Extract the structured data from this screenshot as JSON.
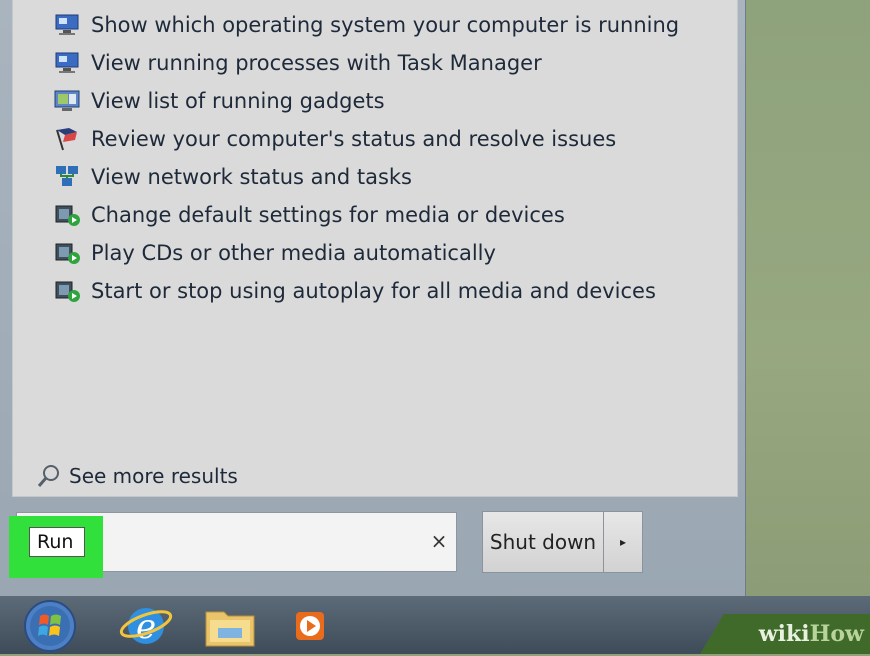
{
  "results": [
    {
      "label": "Show which operating system your computer is running",
      "icon": "system-icon"
    },
    {
      "label": "View running processes with Task Manager",
      "icon": "system-icon"
    },
    {
      "label": "View list of running gadgets",
      "icon": "gadgets-icon"
    },
    {
      "label": "Review your computer's status and resolve issues",
      "icon": "action-center-flag-icon"
    },
    {
      "label": "View network status and tasks",
      "icon": "network-icon"
    },
    {
      "label": "Change default settings for media or devices",
      "icon": "autoplay-icon"
    },
    {
      "label": "Play CDs or other media automatically",
      "icon": "autoplay-icon"
    },
    {
      "label": "Start or stop using autoplay for all media and devices",
      "icon": "autoplay-icon"
    }
  ],
  "see_more": "See more results",
  "search": {
    "value": "Run",
    "clear": "×"
  },
  "shutdown": {
    "label": "Shut down",
    "arrow": "▸"
  },
  "taskbar": [
    "start-orb",
    "internet-explorer",
    "file-explorer",
    "media-player"
  ],
  "watermark": {
    "wiki": "wiki",
    "how": "How"
  },
  "colors": {
    "highlight": "#32e03b",
    "taskbar": "#4a5866",
    "results_bg": "#dadada"
  }
}
